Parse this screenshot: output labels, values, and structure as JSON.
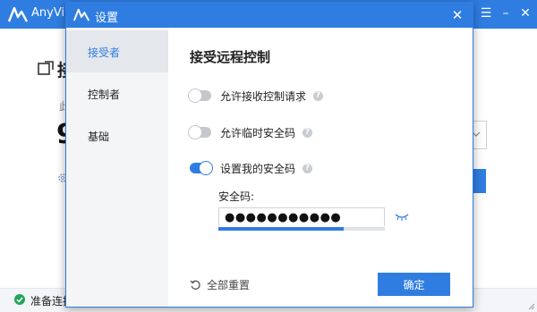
{
  "main_window": {
    "title": "AnyView",
    "heading": "接",
    "subtitle": "此",
    "id_number": "9",
    "status_text": "准备连接",
    "accent_color": "#2f7de1"
  },
  "dialog": {
    "title": "设置",
    "sidebar": {
      "items": [
        {
          "label": "接受者",
          "active": true
        },
        {
          "label": "控制者",
          "active": false
        },
        {
          "label": "基础",
          "active": false
        }
      ]
    },
    "section_title": "接受远程控制",
    "options": [
      {
        "label": "允许接收控制请求",
        "enabled": false
      },
      {
        "label": "允许临时安全码",
        "enabled": false
      },
      {
        "label": "设置我的安全码",
        "enabled": true
      }
    ],
    "password": {
      "label": "安全码:",
      "value": "●●●●●●●●●●●",
      "strength": 0.75
    },
    "reset_label": "全部重置",
    "ok_label": "确定"
  }
}
